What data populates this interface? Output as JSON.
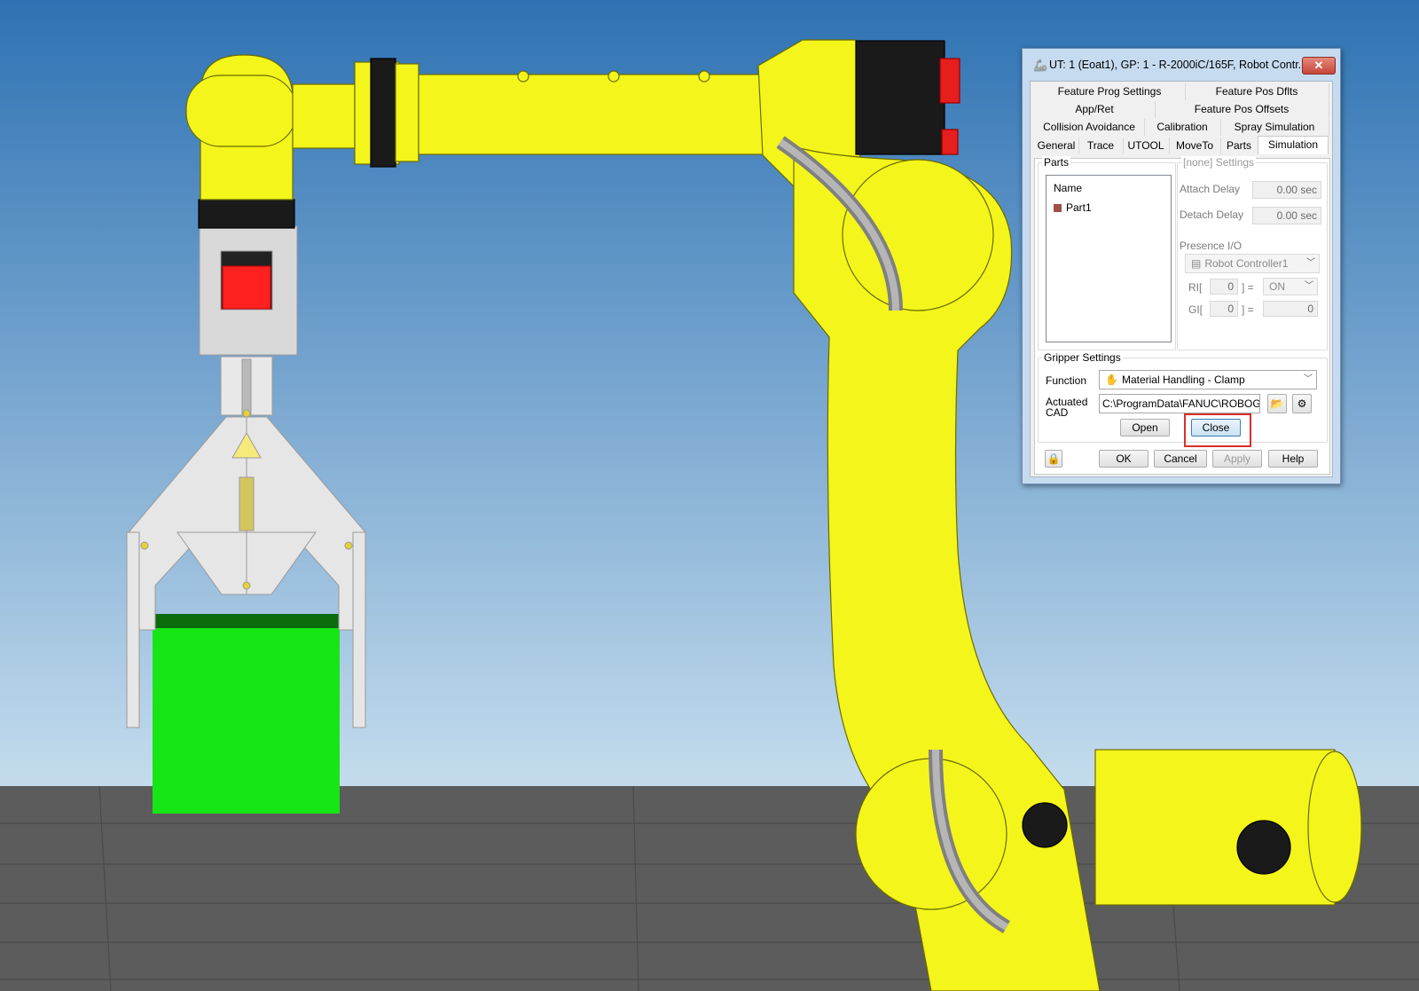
{
  "dialog": {
    "title": "UT: 1  (Eoat1), GP: 1 - R-2000iC/165F, Robot Contr...",
    "close_label": "✕",
    "tabs_row1": [
      "Feature Prog Settings",
      "Feature Pos Dflts"
    ],
    "tabs_row2": [
      "App/Ret",
      "Feature Pos Offsets"
    ],
    "tabs_row3": [
      "Collision Avoidance",
      "Calibration",
      "Spray Simulation"
    ],
    "tabs_row4": [
      "General",
      "Trace",
      "UTOOL",
      "MoveTo",
      "Parts",
      "Simulation"
    ],
    "active_tab": "Simulation",
    "parts": {
      "group_label": "Parts",
      "column_header": "Name",
      "items": [
        "Part1"
      ]
    },
    "settings": {
      "group_label": "[none] Settings",
      "attach_delay_label": "Attach Delay",
      "attach_delay_value": "0.00",
      "attach_delay_unit": "sec",
      "detach_delay_label": "Detach Delay",
      "detach_delay_value": "0.00",
      "detach_delay_unit": "sec",
      "presence_io_label": "Presence I/O",
      "controller": "Robot Controller1",
      "ri_label": "RI[",
      "ri_index": "0",
      "ri_eq": "] =",
      "ri_value": "ON",
      "gi_label": "GI[",
      "gi_index": "0",
      "gi_eq": "] =",
      "gi_value": "0"
    },
    "gripper": {
      "group_label": "Gripper Settings",
      "function_label": "Function",
      "function_value": "Material Handling - Clamp",
      "actuated_label_1": "Actuated",
      "actuated_label_2": "CAD",
      "actuated_path": "C:\\ProgramData\\FANUC\\ROBOGUID",
      "open_label": "Open",
      "close_label": "Close"
    },
    "footer": {
      "ok_label": "OK",
      "cancel_label": "Cancel",
      "apply_label": "Apply",
      "help_label": "Help"
    }
  },
  "colors": {
    "robot": "#f4f51b",
    "part": "#16e516",
    "sky_top": "#2e72b3",
    "sky_bottom": "#c4dced",
    "floor": "#5c5c5c"
  }
}
